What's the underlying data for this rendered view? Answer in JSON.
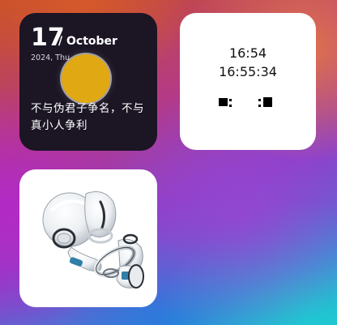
{
  "calendar_widget": {
    "day": "17",
    "month": "/ October",
    "date_line": "2024, Thu",
    "quote": "不与伪君子争名，不与真小人争利",
    "sun_color": "#e0a812",
    "background_color": "#1b1524"
  },
  "clock_widget": {
    "time_short": "16:54",
    "time_full": "16:55:34",
    "background_color": "#ffffff"
  },
  "image_widget": {
    "icon": "robot-illustration-icon",
    "background_color": "#ffffff"
  }
}
